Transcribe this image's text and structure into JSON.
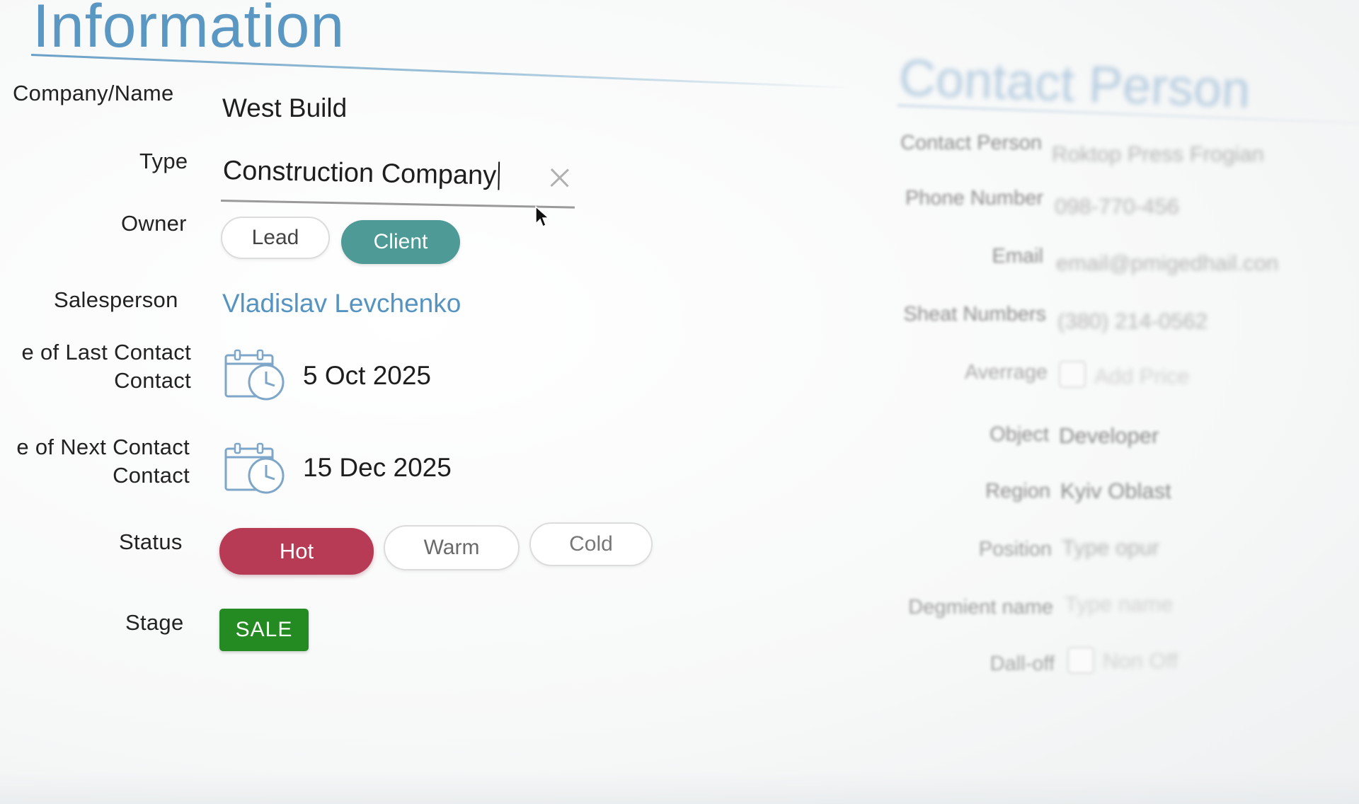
{
  "section": {
    "title": "Information"
  },
  "form": {
    "company_label": "Company/Name",
    "company_value": "West Build",
    "type_label": "Type",
    "type_value": "Construction Company",
    "owner_label": "Owner",
    "owner_options": [
      "Lead",
      "Client"
    ],
    "owner_selected": "Client",
    "salesperson_label": "Salesperson",
    "salesperson_value": "Vladislav Levchenko",
    "last_contact_label_line1": "e of Last Contact",
    "last_contact_label_line2": "Contact",
    "last_contact_value": "5 Oct 2025",
    "next_contact_label_line1": "e of Next Contact",
    "next_contact_label_line2": "Contact",
    "next_contact_value": "15 Dec 2025",
    "status_label": "Status",
    "status_options": [
      "Hot",
      "Warm",
      "Cold"
    ],
    "status_selected": "Hot",
    "stage_label": "Stage",
    "stage_value": "SALE"
  },
  "contact_panel": {
    "title": "Contact Person",
    "fields": [
      {
        "label": "Contact Person",
        "value": "Roktop Press Frogian"
      },
      {
        "label": "Phone Number",
        "value": "098-770-456"
      },
      {
        "label": "Email",
        "value": "email@pmigedhail.con"
      },
      {
        "label": "Sheat Numbers",
        "value": "(380) 214-0562"
      },
      {
        "label": "Averrage",
        "value": "Add Price"
      },
      {
        "label": "Object",
        "value": "Developer"
      },
      {
        "label": "Region",
        "value": "Kyiv Oblast"
      },
      {
        "label": "Position",
        "value": "Type opur"
      },
      {
        "label": "Degmient name",
        "value": "Type name"
      },
      {
        "label": "Dall-off",
        "value": "Non Off"
      }
    ]
  },
  "icons": {
    "clear": "close-icon",
    "calendar": "calendar-clock-icon",
    "cursor": "mouse-pointer-icon"
  },
  "colors": {
    "accent_blue": "#5a97c2",
    "client_teal": "#4d9a96",
    "hot_red": "#b73b55",
    "sale_green": "#248a22"
  }
}
